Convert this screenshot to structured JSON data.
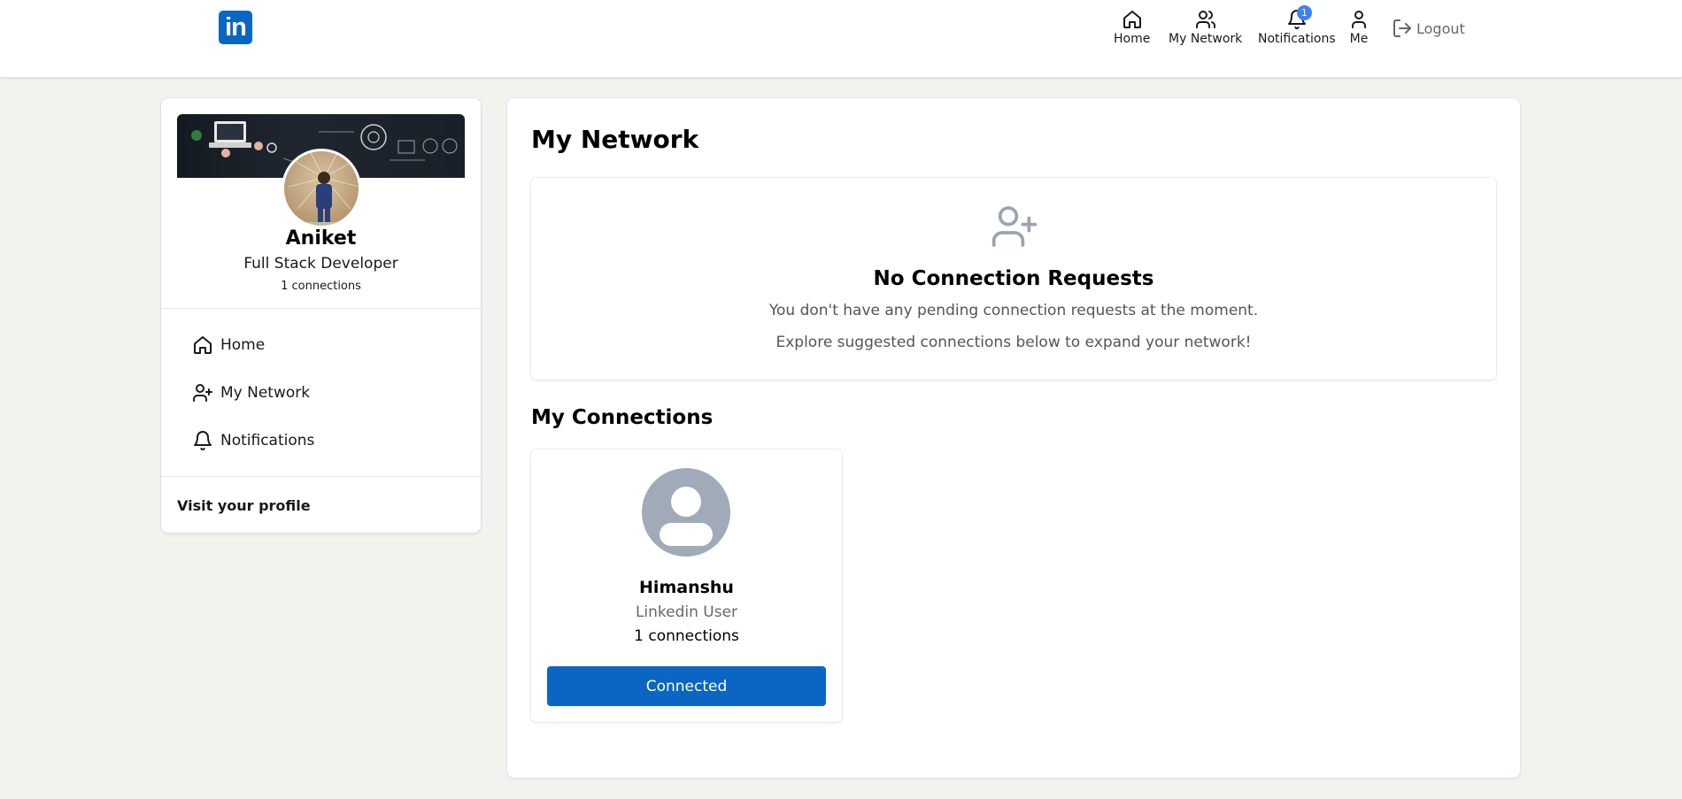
{
  "brand": {
    "logo_text": "in",
    "accent": "#0a66c2"
  },
  "nav": {
    "items": [
      {
        "label": "Home",
        "icon": "home-icon"
      },
      {
        "label": "My Network",
        "icon": "users-icon"
      },
      {
        "label": "Notifications",
        "icon": "bell-icon",
        "badge": "1"
      },
      {
        "label": "Me",
        "icon": "user-icon"
      }
    ],
    "logout_label": "Logout"
  },
  "profile": {
    "name": "Aniket",
    "headline": "Full Stack Developer",
    "connections": "1 connections",
    "menu": [
      {
        "label": "Home",
        "icon": "home-icon"
      },
      {
        "label": "My Network",
        "icon": "user-plus-icon"
      },
      {
        "label": "Notifications",
        "icon": "bell-icon"
      }
    ],
    "visit_profile": "Visit your profile"
  },
  "main": {
    "title": "My Network",
    "empty": {
      "title": "No Connection Requests",
      "line1": "You don't have any pending connection requests at the moment.",
      "line2": "Explore suggested connections below to expand your network!"
    },
    "connections_title": "My Connections",
    "connections": [
      {
        "name": "Himanshu",
        "role": "Linkedin User",
        "connections": "1 connections",
        "button": "Connected"
      }
    ]
  }
}
